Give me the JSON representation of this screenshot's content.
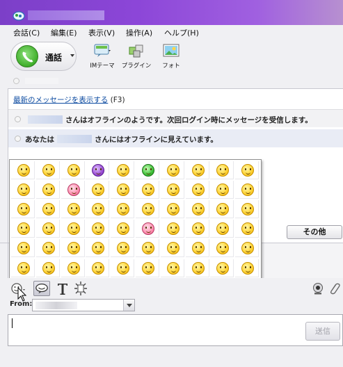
{
  "menu": {
    "items": [
      {
        "label": "会話(C)"
      },
      {
        "label": "編集(E)"
      },
      {
        "label": "表示(V)"
      },
      {
        "label": "操作(A)"
      },
      {
        "label": "ヘルプ(H)"
      }
    ]
  },
  "toolbar": {
    "call_label": "通話",
    "items": [
      {
        "label": "IMテーマ",
        "icon": "im-theme-icon"
      },
      {
        "label": "プラグイン",
        "icon": "plugin-icon"
      },
      {
        "label": "フォト",
        "icon": "photo-icon"
      }
    ]
  },
  "conversation": {
    "recent_link": "最新のメッセージを表示する",
    "recent_hint": "(F3)",
    "messages": [
      {
        "prefix": "",
        "suffix": "さんはオフラインのようです。次回ログイン時にメッセージを受信します。"
      },
      {
        "prefix": "あなたは",
        "suffix": "さんにはオフラインに見えています。"
      }
    ]
  },
  "emoticon_panel": {
    "rows": 6,
    "cols": 10,
    "special": {
      "0-3": "purple",
      "0-5": "green",
      "1-2": "pink",
      "3-5": "pink"
    }
  },
  "buttons": {
    "other": "その他",
    "send": "送信"
  },
  "from_label": "From:",
  "colors": {
    "title_gradient_start": "#7c3fc8",
    "link": "#0b4aa0",
    "call_green": "#3fae2a"
  }
}
